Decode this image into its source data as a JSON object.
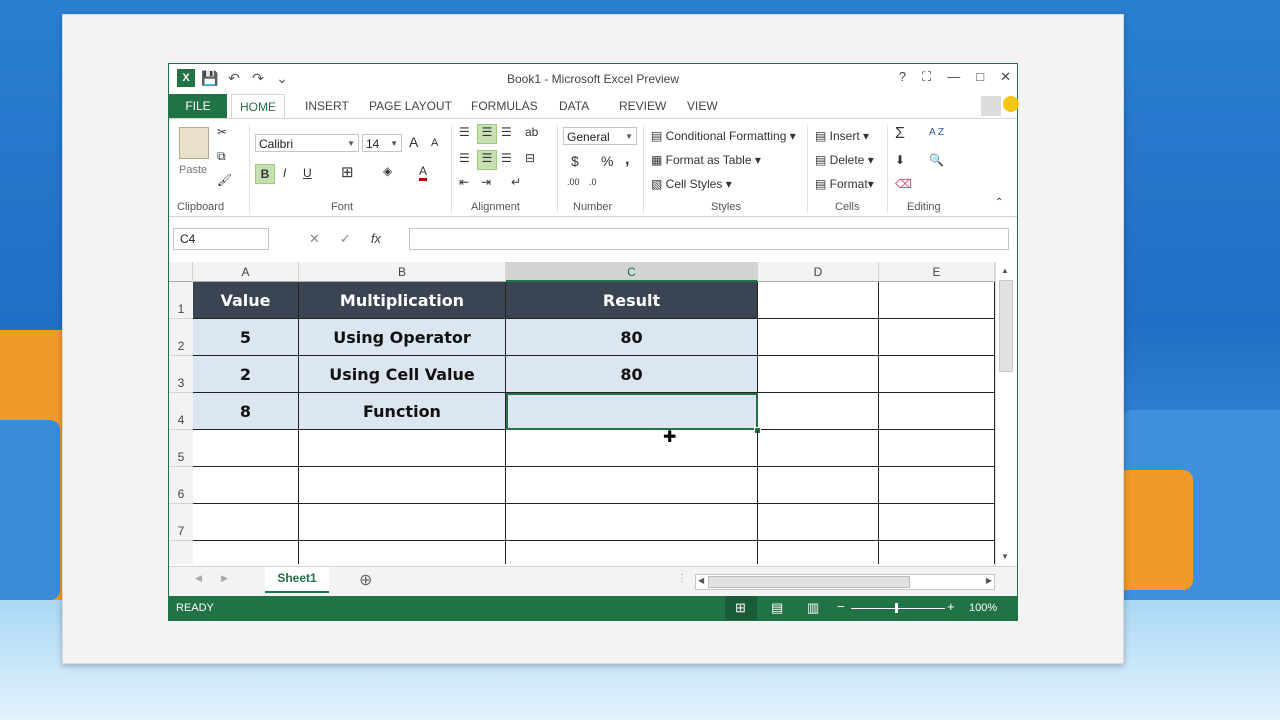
{
  "window": {
    "title": "Book1 - Microsoft Excel Preview",
    "help": "?",
    "restore_ribbon": "⛶",
    "minimize": "—",
    "maximize": "□",
    "close": "✕"
  },
  "qat": {
    "app_icon": "X",
    "save_icon": "save-icon",
    "undo_icon": "undo-icon",
    "redo_icon": "redo-icon",
    "customize_icon": "customize-icon"
  },
  "tabs": [
    "FILE",
    "HOME",
    "INSERT",
    "PAGE LAYOUT",
    "FORMULAS",
    "DATA",
    "REVIEW",
    "VIEW"
  ],
  "ribbon": {
    "clipboard": {
      "paste": "Paste",
      "label": "Clipboard"
    },
    "font": {
      "name": "Calibri",
      "size": "14",
      "bold": "B",
      "italic": "I",
      "underline": "U",
      "grow": "A",
      "shrink": "A",
      "color": "A",
      "label": "Font"
    },
    "alignment": {
      "label": "Alignment"
    },
    "number": {
      "format": "General",
      "currency": "$",
      "percent": "%",
      "comma": ",",
      "label": "Number"
    },
    "styles": {
      "conditional": "Conditional Formatting",
      "format_table": "Format as Table",
      "cell_styles": "Cell Styles",
      "label": "Styles"
    },
    "cells": {
      "insert": "Insert",
      "delete": "Delete",
      "format": "Format",
      "label": "Cells"
    },
    "editing": {
      "sum": "Σ",
      "sort": "A Z",
      "label": "Editing"
    }
  },
  "formula_bar": {
    "name_box": "C4",
    "cancel": "✕",
    "enter": "✓",
    "fx": "fx",
    "value": ""
  },
  "columns": [
    "A",
    "B",
    "C",
    "D",
    "E"
  ],
  "rows": [
    "1",
    "2",
    "3",
    "4",
    "5",
    "6",
    "7"
  ],
  "table": {
    "headers": [
      "Value",
      "Multiplication",
      "Result"
    ],
    "rows": [
      [
        "5",
        "Using Operator",
        "80"
      ],
      [
        "2",
        "Using Cell Value",
        "80"
      ],
      [
        "8",
        "Function",
        ""
      ]
    ]
  },
  "sheet_tabs": {
    "active": "Sheet1",
    "add": "⊕"
  },
  "status": {
    "mode": "READY",
    "zoom": "100%"
  }
}
